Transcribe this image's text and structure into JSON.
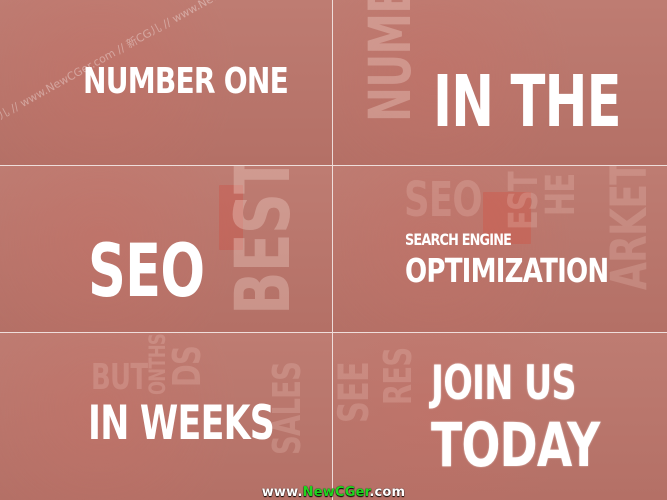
{
  "panels": [
    {
      "id": "p1",
      "main": "NUMBER ONE",
      "ghosts": []
    },
    {
      "id": "p2",
      "main": "IN THE",
      "ghosts": [
        "NUMB"
      ]
    },
    {
      "id": "p3",
      "main": "SEO",
      "ghosts": [
        "BEST"
      ]
    },
    {
      "id": "p4",
      "small": "SEARCH ENGINE",
      "big": "OPTIMIZATION",
      "ghosts": [
        "SEO",
        "EST",
        "HE",
        "ARKET"
      ]
    },
    {
      "id": "p5",
      "main": "IN WEEKS",
      "ghosts": [
        "BUT",
        "DS",
        "ONTHS",
        "SALES"
      ]
    },
    {
      "id": "p6",
      "main_line1": "JOIN US",
      "main_line2": "TODAY",
      "ghosts": [
        "SEE",
        "RES"
      ]
    }
  ],
  "watermark": "CG儿 // www.NewCGer.com // 新CG儿 // www.NewCGer.com // 新CG儿 // www.NewCGer.com // 新CG儿 // www.",
  "footer": {
    "prefix": "www.",
    "brand": "NewCGer",
    "suffix": ".com"
  }
}
